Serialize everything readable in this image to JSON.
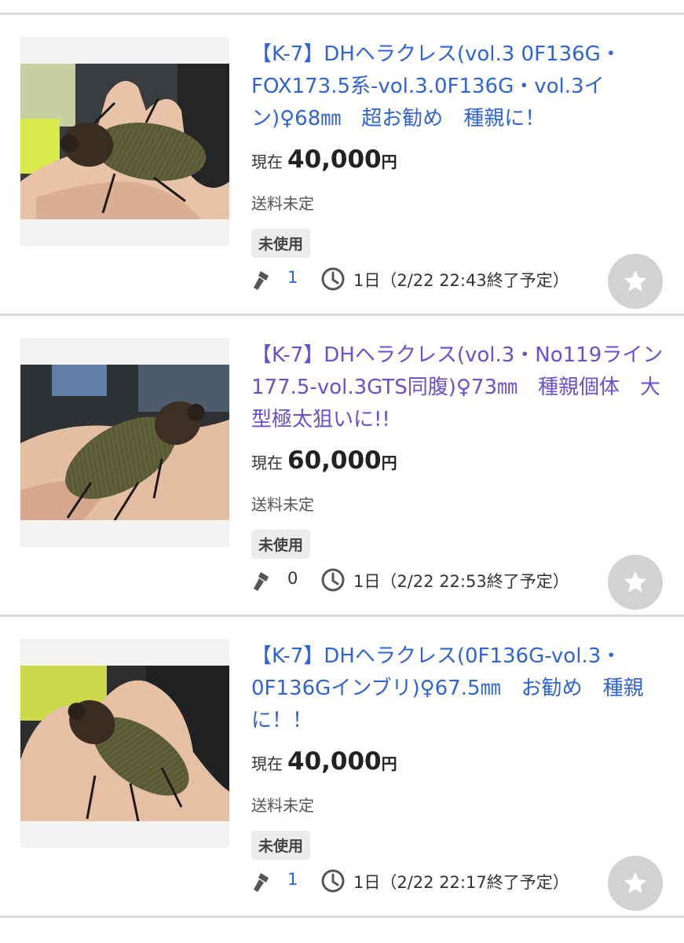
{
  "colors": {
    "title_link": "#2f63d8",
    "title_visited": "#6a4fd0",
    "divider": "#dcdcdc",
    "watch_button": "#d2d2d2"
  },
  "icons": {
    "bid": "gavel-icon",
    "time": "clock-icon",
    "watch": "star-icon"
  },
  "items": [
    {
      "title": "【K-7】DHヘラクレス(vol.3 0F136G・FOX173.5系-vol.3.0F136G・vol.3イン)♀68㎜　超お勧め　種親に！",
      "visited": false,
      "price_label": "現在",
      "price": "40,000",
      "price_unit": "円",
      "shipping": "送料未定",
      "condition": "未使用",
      "bids": "1",
      "time_left": "1日（2/22 22:43終了予定）"
    },
    {
      "title": "【K-7】DHヘラクレス(vol.3・No119ライン177.5-vol.3GTS同腹)♀73㎜　種親個体　大型極太狙いに!!",
      "visited": true,
      "price_label": "現在",
      "price": "60,000",
      "price_unit": "円",
      "shipping": "送料未定",
      "condition": "未使用",
      "bids": "0",
      "time_left": "1日（2/22 22:53終了予定）"
    },
    {
      "title": "【K-7】DHヘラクレス(0F136G-vol.3・0F136Gインブリ)♀67.5㎜　お勧め　種親に！！",
      "visited": false,
      "price_label": "現在",
      "price": "40,000",
      "price_unit": "円",
      "shipping": "送料未定",
      "condition": "未使用",
      "bids": "1",
      "time_left": "1日（2/22 22:17終了予定）"
    }
  ]
}
